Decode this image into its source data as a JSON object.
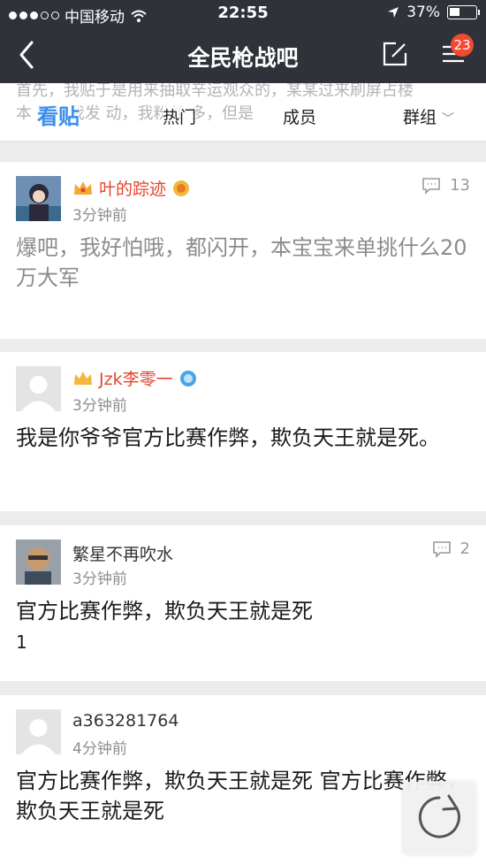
{
  "status_bar": {
    "carrier": "中国移动",
    "time": "22:55",
    "battery": "37%"
  },
  "nav": {
    "title": "全民枪战吧",
    "menu_badge": "23"
  },
  "tabs": {
    "active": "看贴",
    "hot": "热门",
    "members": "成员",
    "groups": "群组",
    "ghost_line1": "首先，我贴于是用来抽取辛运观众的，某某过来刷屏占楼",
    "ghost_line2": "本    影响我发    动，我粉丝    多，但是"
  },
  "posts": [
    {
      "author": "叶的踪迹",
      "time": "3分钟前",
      "comment_count": "13",
      "content": "爆吧，我好怕哦，都闪开，本宝宝来单挑什么20万大军"
    },
    {
      "author": "Jzk李零一",
      "time": "3分钟前",
      "content": "我是你爷爷官方比赛作弊，欺负天王就是死。"
    },
    {
      "author": "繁星不再吹水",
      "time": "3分钟前",
      "comment_count": "2",
      "content": "官方比赛作弊，欺负天王就是死",
      "subline": "1"
    },
    {
      "author": "a363281764",
      "time": "4分钟前",
      "content": "官方比赛作弊，欺负天王就是死 官方比赛作弊，欺负天王就是死"
    }
  ],
  "colors": {
    "nav_bg": "#2f3339",
    "accent": "#3a8ef0",
    "vip_red": "#e4452f",
    "badge": "#f04a32"
  }
}
